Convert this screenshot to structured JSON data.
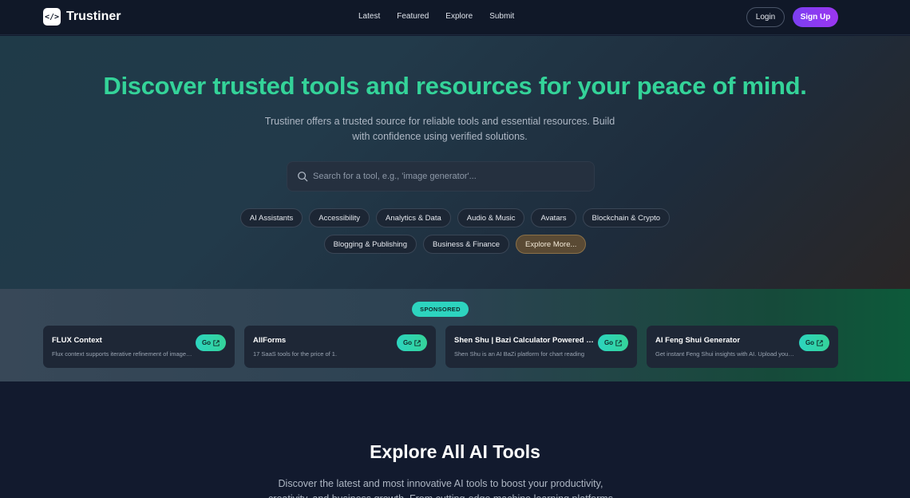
{
  "nav": {
    "brand": "Trustiner",
    "logo_glyph": "</>",
    "links": [
      "Latest",
      "Featured",
      "Explore",
      "Submit"
    ],
    "login_label": "Login",
    "signup_label": "Sign Up"
  },
  "hero": {
    "title": "Discover trusted tools and resources for your peace of mind.",
    "subtitle": "Trustiner offers a trusted source for reliable tools and essential resources. Build with confidence using verified solutions.",
    "search_placeholder": "Search for a tool, e.g., 'image generator'...",
    "categories_row1": [
      "AI Assistants",
      "Accessibility",
      "Analytics & Data",
      "Audio & Music",
      "Avatars",
      "Blockchain & Crypto"
    ],
    "categories_row2": [
      "Blogging & Publishing",
      "Business & Finance"
    ],
    "explore_more_label": "Explore More..."
  },
  "sponsored": {
    "badge": "SPONSORED",
    "cards": [
      {
        "title": "FLUX Context",
        "description": "Flux context supports iterative refinement of images through natural language",
        "go_label": "Go"
      },
      {
        "title": "AllForms",
        "description": "17 SaaS tools for the price of 1.",
        "go_label": "Go"
      },
      {
        "title": "Shen Shu | Bazi Calculator Powered by AI",
        "description": "Shen Shu is an AI BaZi platform for chart reading",
        "go_label": "Go"
      },
      {
        "title": "AI Feng Shui Generator",
        "description": "Get instant Feng Shui insights with AI. Upload your floor plan",
        "go_label": "Go"
      }
    ]
  },
  "explore": {
    "title": "Explore All AI Tools",
    "subtitle": "Discover the latest and most innovative AI tools to boost your productivity, creativity, and business growth. From cutting-edge machine learning platforms"
  },
  "icons": {
    "logo": "code-brackets-icon",
    "search": "search-icon",
    "external": "external-link-icon"
  },
  "colors": {
    "accent_green": "#34d399",
    "signup_purple": "#7b3ff2",
    "go_teal": "#2dd4bf",
    "background": "#121a2e"
  }
}
